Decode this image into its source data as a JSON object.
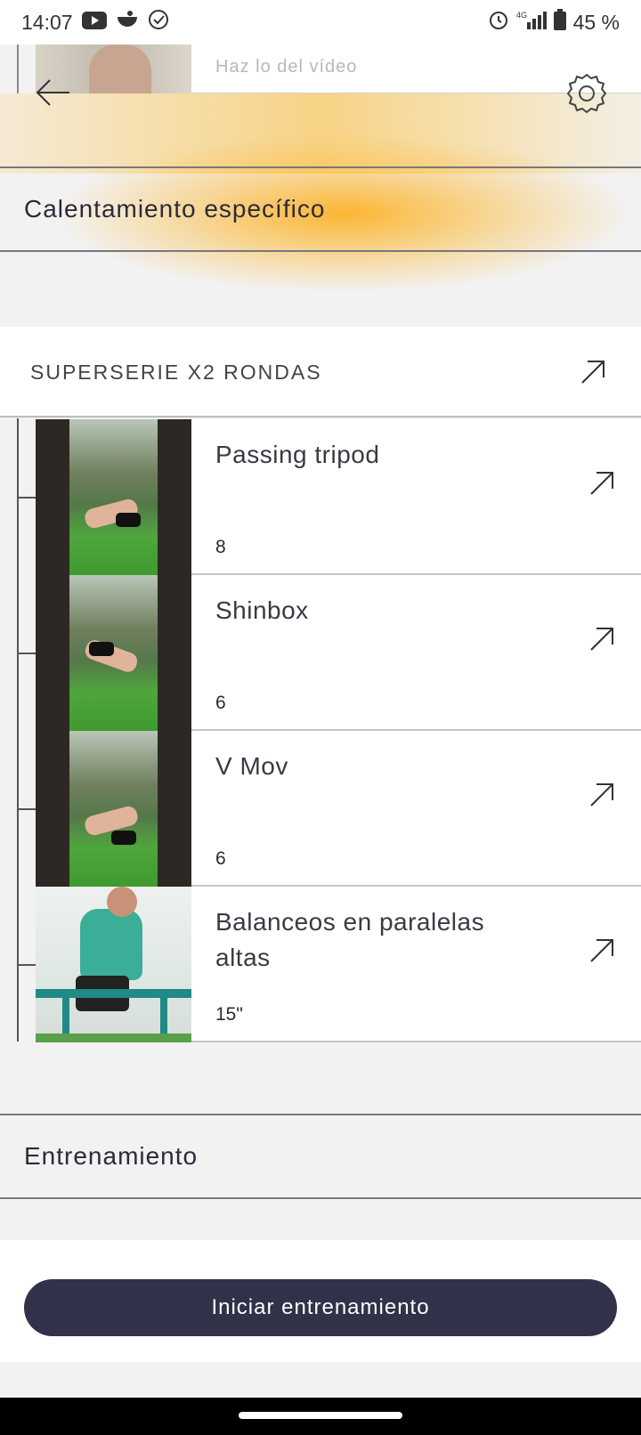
{
  "status_bar": {
    "time": "14:07",
    "battery": "45 %",
    "network": "4G",
    "icons_left": [
      "youtube-icon",
      "notification-icon",
      "check-circle-icon"
    ],
    "icons_right": [
      "alarm-icon",
      "signal-icon",
      "battery-icon"
    ]
  },
  "top_item": {
    "instruction": "Haz lo del vídeo"
  },
  "sections": {
    "warmup_title": "Calentamiento específico",
    "training_title": "Entrenamiento"
  },
  "superserie": {
    "label": "SUPERSERIE X2 RONDAS"
  },
  "exercises": [
    {
      "name": "Passing tripod",
      "reps": "8"
    },
    {
      "name": "Shinbox",
      "reps": "6"
    },
    {
      "name": "V Mov",
      "reps": "6"
    },
    {
      "name": "Balanceos en paralelas altas",
      "reps": "15\""
    }
  ],
  "actions": {
    "start_label": "Iniciar entrenamiento"
  },
  "colors": {
    "accent": "#fcb228",
    "button": "#31314a",
    "background": "#f2f2f2"
  }
}
